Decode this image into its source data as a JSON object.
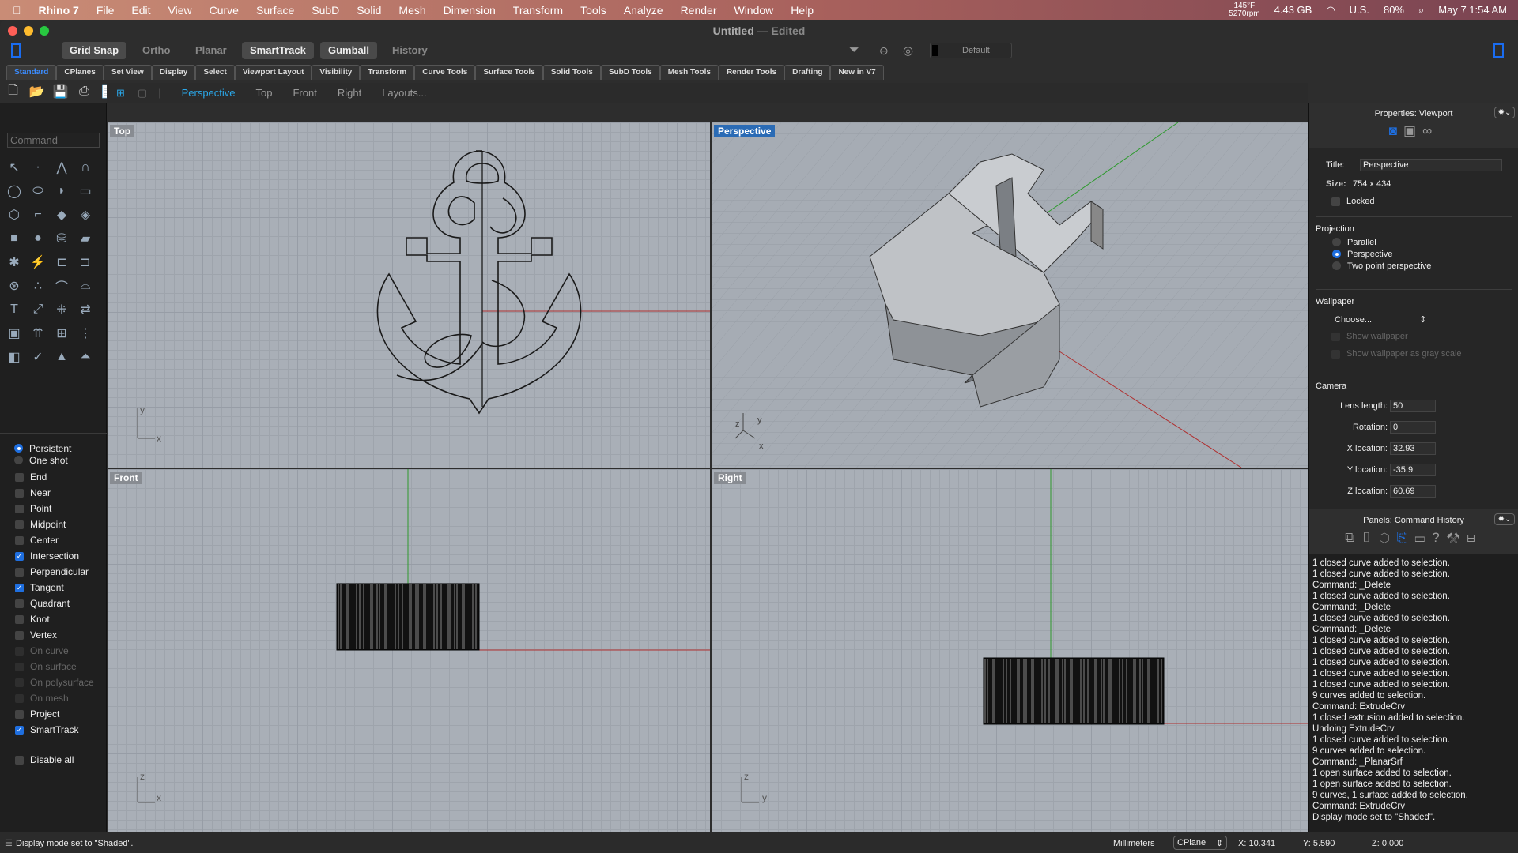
{
  "menubar": {
    "app": "Rhino 7",
    "items": [
      "File",
      "Edit",
      "View",
      "Curve",
      "Surface",
      "SubD",
      "Solid",
      "Mesh",
      "Dimension",
      "Transform",
      "Tools",
      "Analyze",
      "Render",
      "Window",
      "Help"
    ],
    "status": {
      "temp": "145°F",
      "rpm": "5270rpm",
      "memory": "4.43 GB",
      "input": "U.S.",
      "battery": "80%",
      "datetime": "May 7  1:54 AM"
    }
  },
  "window": {
    "title": "Untitled",
    "state": "— Edited"
  },
  "toggles": {
    "grid_snap": "Grid Snap",
    "ortho": "Ortho",
    "planar": "Planar",
    "smarttrack": "SmartTrack",
    "gumball": "Gumball",
    "history": "History",
    "layer": "Default"
  },
  "toolbar_tabs": [
    "Standard",
    "CPlanes",
    "Set View",
    "Display",
    "Select",
    "Viewport Layout",
    "Visibility",
    "Transform",
    "Curve Tools",
    "Surface Tools",
    "Solid Tools",
    "SubD Tools",
    "Mesh Tools",
    "Render Tools",
    "Drafting",
    "New in V7"
  ],
  "viewport_tabs": [
    "Perspective",
    "Top",
    "Front",
    "Right",
    "Layouts..."
  ],
  "command": {
    "placeholder": "Command"
  },
  "osnap": {
    "modes": [
      "Persistent",
      "One shot"
    ],
    "items": [
      {
        "label": "End",
        "checked": false
      },
      {
        "label": "Near",
        "checked": false
      },
      {
        "label": "Point",
        "checked": false
      },
      {
        "label": "Midpoint",
        "checked": false
      },
      {
        "label": "Center",
        "checked": false
      },
      {
        "label": "Intersection",
        "checked": true
      },
      {
        "label": "Perpendicular",
        "checked": false
      },
      {
        "label": "Tangent",
        "checked": true
      },
      {
        "label": "Quadrant",
        "checked": false
      },
      {
        "label": "Knot",
        "checked": false
      },
      {
        "label": "Vertex",
        "checked": false
      },
      {
        "label": "On curve",
        "checked": false,
        "disabled": true
      },
      {
        "label": "On surface",
        "checked": false,
        "disabled": true
      },
      {
        "label": "On polysurface",
        "checked": false,
        "disabled": true
      },
      {
        "label": "On mesh",
        "checked": false,
        "disabled": true
      },
      {
        "label": "Project",
        "checked": false
      },
      {
        "label": "SmartTrack",
        "checked": true
      }
    ],
    "disable_all": "Disable all"
  },
  "viewports": {
    "top": "Top",
    "perspective": "Perspective",
    "front": "Front",
    "right": "Right",
    "axes": {
      "x": "x",
      "y": "y",
      "z": "z"
    }
  },
  "properties": {
    "header": "Properties: Viewport",
    "title_label": "Title:",
    "title_value": "Perspective",
    "size_label": "Size:",
    "size_value": "754 x 434",
    "locked": "Locked",
    "projection": "Projection",
    "proj_options": [
      "Parallel",
      "Perspective",
      "Two point perspective"
    ],
    "wallpaper": "Wallpaper",
    "choose": "Choose...",
    "show_wallpaper": "Show wallpaper",
    "show_gray": "Show wallpaper as gray scale",
    "camera": "Camera",
    "lens_label": "Lens length:",
    "lens": "50",
    "rotation_label": "Rotation:",
    "rotation": "0",
    "x_label": "X location:",
    "x": "32.93",
    "y_label": "Y location:",
    "y": "-35.9",
    "z_label": "Z location:",
    "z": "60.69"
  },
  "history": {
    "header": "Panels: Command History",
    "lines": [
      "1 closed curve added to selection.",
      "1 closed curve added to selection.",
      "Command: _Delete",
      "1 closed curve added to selection.",
      "Command: _Delete",
      "1 closed curve added to selection.",
      "Command: _Delete",
      "1 closed curve added to selection.",
      "1 closed curve added to selection.",
      "1 closed curve added to selection.",
      "1 closed curve added to selection.",
      "1 closed curve added to selection.",
      "9 curves added to selection.",
      "Command: ExtrudeCrv",
      "1 closed extrusion added to selection.",
      "Undoing ExtrudeCrv",
      "1 closed curve added to selection.",
      "9 curves added to selection.",
      "Command: _PlanarSrf",
      "1 open surface added to selection.",
      "1 open surface added to selection.",
      "9 curves, 1 surface added to selection.",
      "Command: ExtrudeCrv",
      "Display mode set to \"Shaded\"."
    ]
  },
  "status": {
    "message": "Display mode set to \"Shaded\".",
    "units": "Millimeters",
    "cplane": "CPlane",
    "x": "X: 10.341",
    "y": "Y: 5.590",
    "z": "Z: 0.000"
  },
  "colors": {
    "accent": "#1f6fe0",
    "viewport": "#a9afb7",
    "x_axis": "#b03030",
    "y_axis": "#2e9a2e"
  }
}
